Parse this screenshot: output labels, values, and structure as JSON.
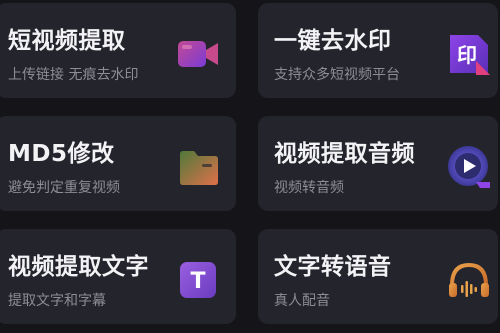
{
  "cards": [
    {
      "title": "短视频提取",
      "subtitle": "上传链接 无痕去水印",
      "icon": "video-camera-icon"
    },
    {
      "title": "一键去水印",
      "subtitle": "支持众多短视频平台",
      "icon": "stamp-icon",
      "icon_text": "印"
    },
    {
      "title": "MD5修改",
      "subtitle": "避免判定重复视频",
      "icon": "folder-icon"
    },
    {
      "title": "视频提取音频",
      "subtitle": "视频转音频",
      "icon": "audio-disc-icon"
    },
    {
      "title": "视频提取文字",
      "subtitle": "提取文字和字幕",
      "icon": "text-t-icon",
      "icon_text": "T"
    },
    {
      "title": "文字转语音",
      "subtitle": "真人配音",
      "icon": "headphones-icon"
    }
  ],
  "colors": {
    "background": "#141419",
    "card": "#24242d",
    "title": "#f3f3f6",
    "subtitle": "#8d8d97",
    "accent_purple": "#8e44e8",
    "accent_pink": "#e0407e"
  }
}
